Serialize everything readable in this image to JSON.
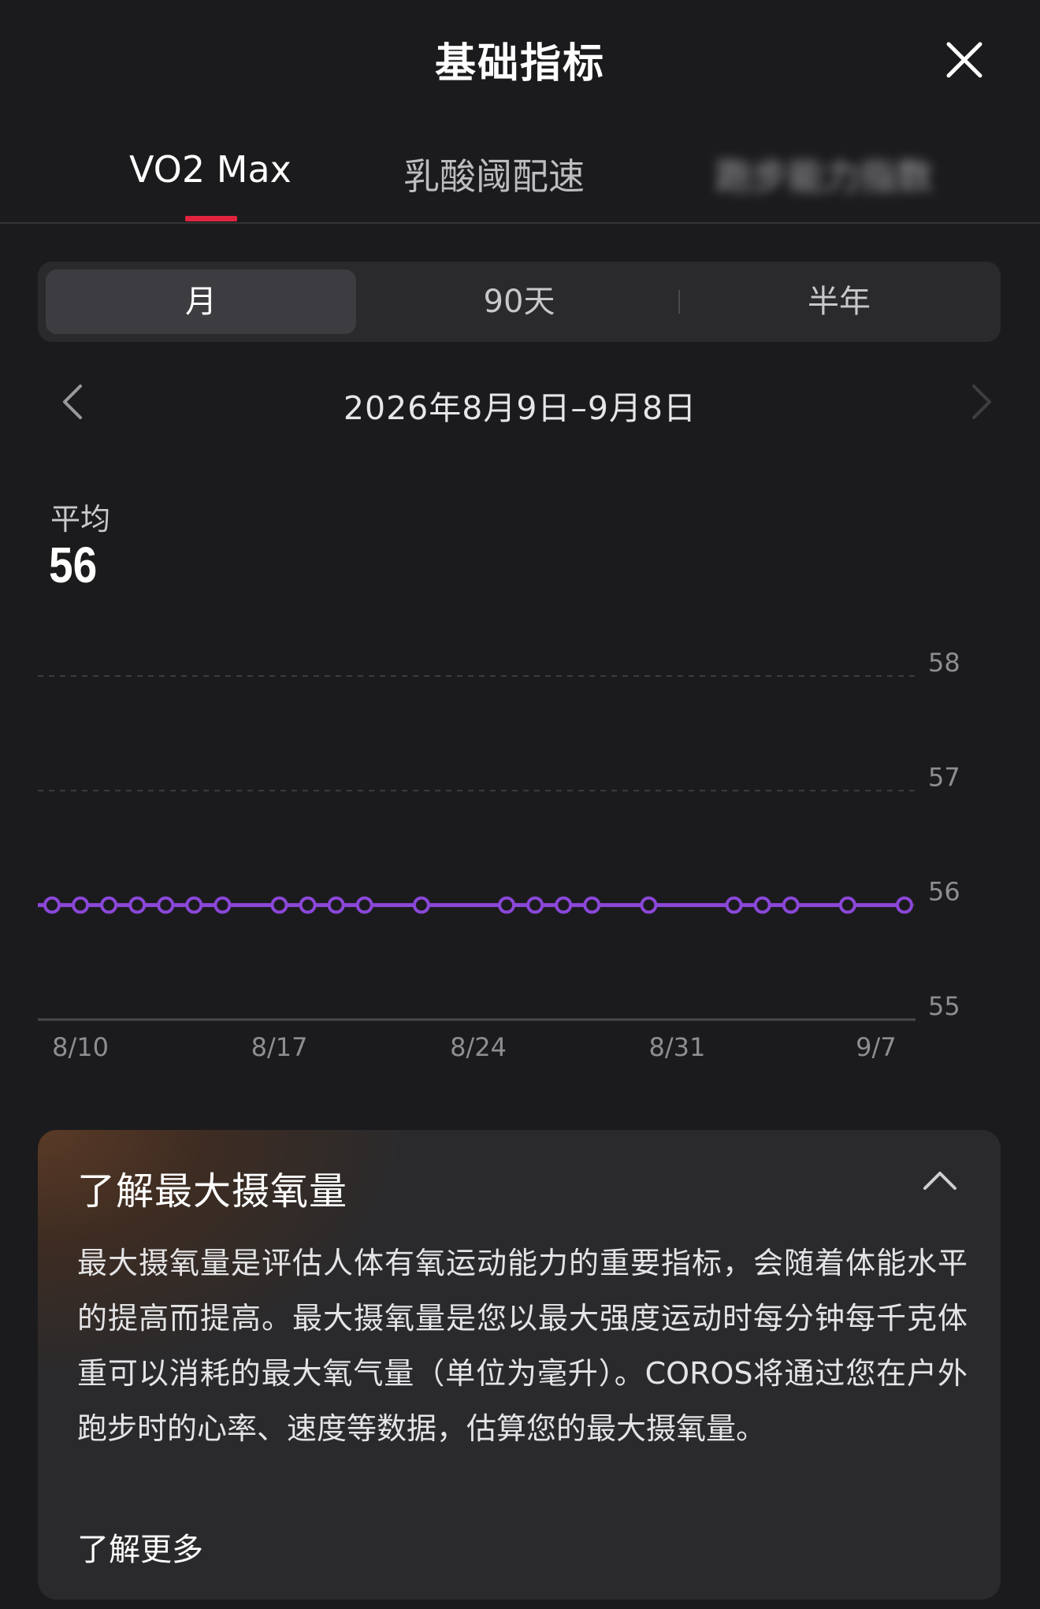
{
  "header": {
    "title": "基础指标"
  },
  "tabs": [
    {
      "label": "VO2 Max",
      "active": true
    },
    {
      "label": "乳酸阈配速",
      "active": false
    },
    {
      "label": "跑步能力指数",
      "active": false
    }
  ],
  "period": {
    "options": [
      "月",
      "90天",
      "半年"
    ],
    "selected": "月"
  },
  "date_nav": {
    "range": "2026年8月9日–9月8日"
  },
  "average": {
    "label": "平均",
    "value": "56"
  },
  "colors": {
    "accent_underline": "#e0243f",
    "series_line": "#8b47d9",
    "background": "#1b1b1d"
  },
  "chart_data": {
    "type": "line",
    "x": [
      "8/9",
      "8/10",
      "8/11",
      "8/12",
      "8/13",
      "8/14",
      "8/15",
      "8/17",
      "8/18",
      "8/19",
      "8/20",
      "8/22",
      "8/25",
      "8/26",
      "8/27",
      "8/28",
      "8/30",
      "9/2",
      "9/3",
      "9/4",
      "9/6",
      "9/8"
    ],
    "values": [
      56,
      56,
      56,
      56,
      56,
      56,
      56,
      56,
      56,
      56,
      56,
      56,
      56,
      56,
      56,
      56,
      56,
      56,
      56,
      56,
      56,
      56
    ],
    "x_ticks": [
      "8/10",
      "8/17",
      "8/24",
      "8/31",
      "9/7"
    ],
    "y_ticks": [
      55,
      56,
      57,
      58
    ],
    "ylim": [
      55,
      58
    ],
    "grid": true,
    "y_axis_position": "right"
  },
  "info": {
    "title": "了解最大摄氧量",
    "body": "最大摄氧量是评估人体有氧运动能力的重要指标，会随着体能水平的提高而提高。最大摄氧量是您以最大强度运动时每分钟每千克体重可以消耗的最大氧气量（单位为毫升）。COROS将通过您在户外跑步时的心率、速度等数据，估算您的最大摄氧量。",
    "link": "了解更多"
  },
  "icons": {
    "close": "close-icon",
    "collapse": "chevron-up-icon",
    "prev": "chevron-left-icon",
    "next": "chevron-right-icon"
  }
}
